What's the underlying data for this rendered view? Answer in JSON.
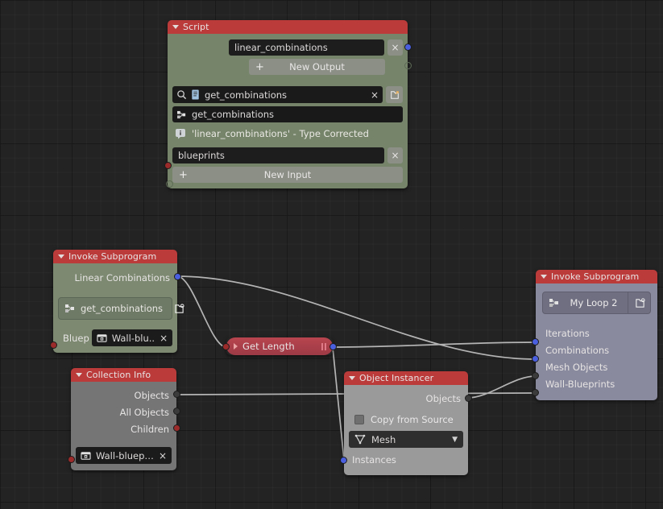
{
  "app": {
    "editor": "blender-node-editor",
    "background_color": "#232323"
  },
  "nodes": {
    "script": {
      "title": "Script",
      "output_name": "linear_combinations",
      "new_output_label": "New Output",
      "script_search_value": "get_combinations",
      "script_name_value": "get_combinations",
      "info_message": "'linear_combinations' - Type Corrected",
      "input_name": "blueprints",
      "new_input_label": "New Input",
      "close_label": "×",
      "header_color": "#bb3b3b",
      "body_color": "#76856a"
    },
    "invoke_left": {
      "title": "Invoke Subprogram",
      "output_socket": "Linear Combinations",
      "subprogram": "get_combinations",
      "input_socket": "Bluep",
      "object_value": "Wall-blu..",
      "close_label": "×",
      "header_color": "#bb3b3b",
      "body_color": "#7d8a71"
    },
    "get_length": {
      "title": "Get Length",
      "collapsed": "true",
      "header_color": "#ab3f4c"
    },
    "collection_info": {
      "title": "Collection Info",
      "outputs": [
        "Objects",
        "All Objects",
        "Children"
      ],
      "collection_value": "Wall-bluepri..",
      "close_label": "×",
      "header_color": "#bb3b3b",
      "body_color": "#757575"
    },
    "object_instancer": {
      "title": "Object Instancer",
      "output_socket": "Objects",
      "checkbox_label": "Copy from Source",
      "checkbox_checked": "false",
      "type_dropdown": "Mesh",
      "input_socket": "Instances",
      "header_color": "#bb3b3b",
      "body_color": "#9a9a9a"
    },
    "invoke_right": {
      "title": "Invoke Subprogram",
      "subprogram": "My Loop 2",
      "inputs": [
        "Iterations",
        "Combinations",
        "Mesh Objects",
        "Wall-Blueprints"
      ],
      "header_color": "#bb3b3b",
      "body_color": "#8a8a9e"
    }
  },
  "icons": {
    "search": "search-icon",
    "script": "script-icon",
    "nodetree": "nodetree-icon",
    "info": "info-icon",
    "open_file": "open-file-icon",
    "object": "object-icon",
    "collection": "collection-icon",
    "mesh": "mesh-data-icon",
    "pause": "pause-icon"
  }
}
